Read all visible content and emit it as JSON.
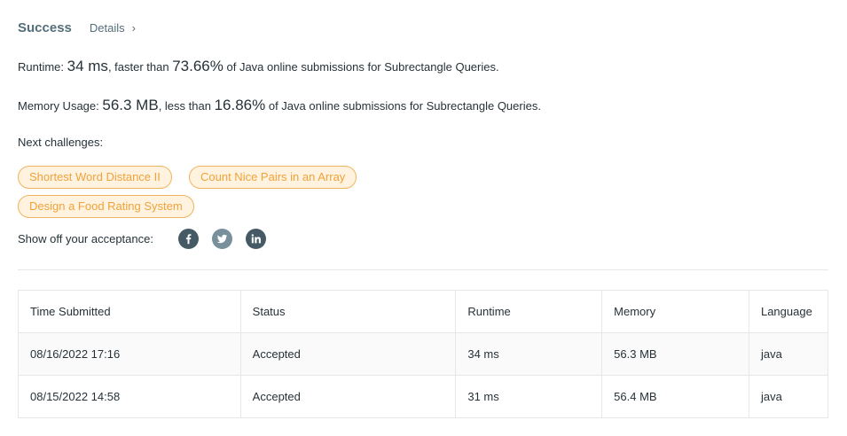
{
  "header": {
    "status": "Success",
    "details_label": "Details"
  },
  "runtime": {
    "label": "Runtime: ",
    "value": "34 ms",
    "mid": ", faster than ",
    "percent": "73.66%",
    "suffix": " of Java online submissions for Subrectangle Queries."
  },
  "memory": {
    "label": "Memory Usage: ",
    "value": "56.3 MB",
    "mid": ", less than ",
    "percent": "16.86%",
    "suffix": " of Java online submissions for Subrectangle Queries."
  },
  "next": {
    "label": "Next challenges:",
    "challenges": [
      "Shortest Word Distance II",
      "Count Nice Pairs in an Array",
      "Design a Food Rating System"
    ]
  },
  "share": {
    "label": "Show off your acceptance:",
    "icons": [
      "facebook-icon",
      "twitter-icon",
      "linkedin-icon"
    ]
  },
  "table": {
    "headers": [
      "Time Submitted",
      "Status",
      "Runtime",
      "Memory",
      "Language"
    ],
    "rows": [
      [
        "08/16/2022 17:16",
        "Accepted",
        "34 ms",
        "56.3 MB",
        "java"
      ],
      [
        "08/15/2022 14:58",
        "Accepted",
        "31 ms",
        "56.4 MB",
        "java"
      ]
    ]
  },
  "colors": {
    "accent": "#f0a23a",
    "pill_bg": "#fff3e0",
    "muted": "#546e7a"
  }
}
